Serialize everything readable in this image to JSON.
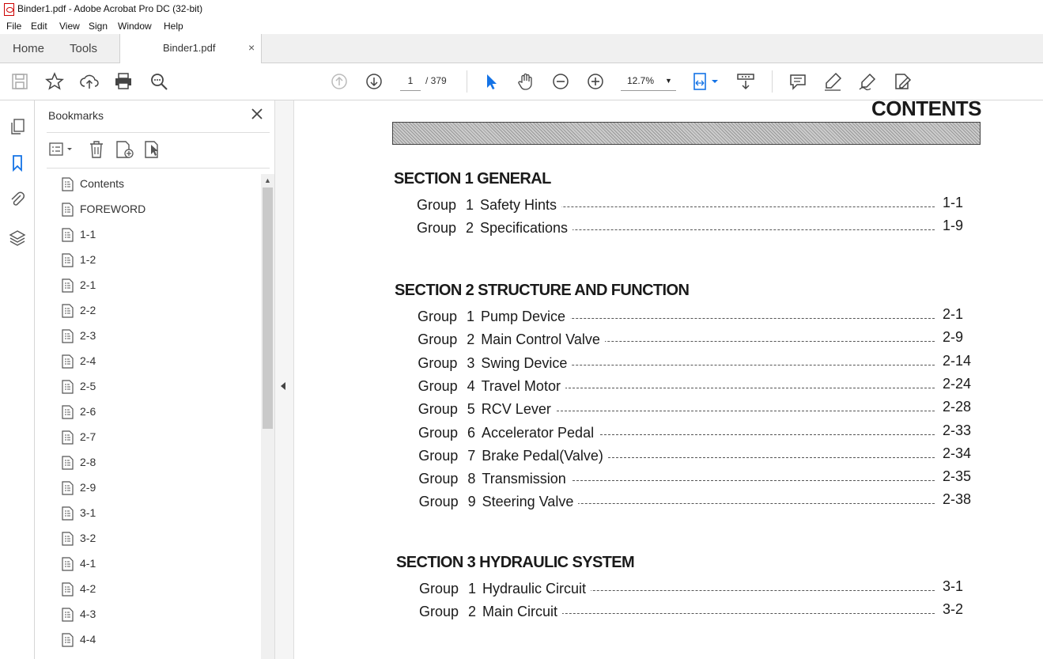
{
  "window": {
    "title": "Binder1.pdf - Adobe Acrobat Pro DC (32-bit)"
  },
  "menu": [
    "File",
    "Edit",
    "View",
    "Sign",
    "Window",
    "Help"
  ],
  "tabs": {
    "home": "Home",
    "tools": "Tools",
    "document": "Binder1.pdf",
    "close": "×"
  },
  "toolbar": {
    "current_page": "1",
    "page_total": "/ 379",
    "zoom": "12.7%"
  },
  "bookmarks": {
    "title": "Bookmarks",
    "items": [
      "Contents",
      "FOREWORD",
      "1-1",
      "1-2",
      "2-1",
      "2-2",
      "2-3",
      "2-4",
      "2-5",
      "2-6",
      "2-7",
      "2-8",
      "2-9",
      "3-1",
      "3-2",
      "4-1",
      "4-2",
      "4-3",
      "4-4"
    ]
  },
  "document": {
    "heading": "CONTENTS",
    "sections": [
      {
        "title": "SECTION 1  GENERAL",
        "rows": [
          {
            "group": "Group",
            "num": "1",
            "name": "Safety Hints",
            "page": "1-1"
          },
          {
            "group": "Group",
            "num": "2",
            "name": "Specifications",
            "page": "1-9"
          }
        ]
      },
      {
        "title": "SECTION 2  STRUCTURE AND FUNCTION",
        "rows": [
          {
            "group": "Group",
            "num": "1",
            "name": "Pump Device",
            "page": "2-1"
          },
          {
            "group": "Group",
            "num": "2",
            "name": "Main Control Valve",
            "page": "2-9"
          },
          {
            "group": "Group",
            "num": "3",
            "name": "Swing Device",
            "page": "2-14"
          },
          {
            "group": "Group",
            "num": "4",
            "name": "Travel Motor",
            "page": "2-24"
          },
          {
            "group": "Group",
            "num": "5",
            "name": "RCV Lever",
            "page": "2-28"
          },
          {
            "group": "Group",
            "num": "6",
            "name": "Accelerator Pedal",
            "page": "2-33"
          },
          {
            "group": "Group",
            "num": "7",
            "name": "Brake Pedal(Valve)",
            "page": "2-34"
          },
          {
            "group": "Group",
            "num": "8",
            "name": "Transmission",
            "page": "2-35"
          },
          {
            "group": "Group",
            "num": "9",
            "name": "Steering Valve",
            "page": "2-38"
          }
        ]
      },
      {
        "title": "SECTION 3  HYDRAULIC SYSTEM",
        "rows": [
          {
            "group": "Group",
            "num": "1",
            "name": "Hydraulic Circuit",
            "page": "3-1"
          },
          {
            "group": "Group",
            "num": "2",
            "name": "Main Circuit",
            "page": "3-2"
          }
        ]
      }
    ]
  }
}
